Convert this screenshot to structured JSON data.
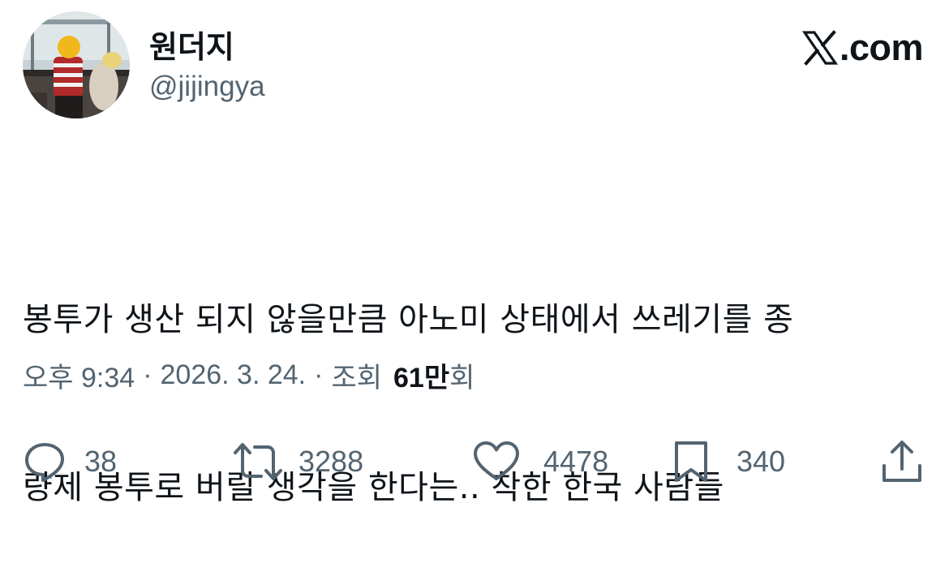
{
  "user": {
    "display_name": "원더지",
    "handle": "@jijingya",
    "avatar_icon": "profile-photo"
  },
  "site": {
    "logo_icon": "x-logo-icon",
    "domain": ".com"
  },
  "tweet": {
    "lines": [
      "봉투가 생산 되지 않을만큼 아노미 상태에서 쓰레기를 종",
      "량제 봉투로 버릴 생각을 한다는.. 착한 한국 사람들"
    ]
  },
  "meta": {
    "time": "오후 9:34",
    "separator": "·",
    "date": "2026. 3. 24.",
    "views_label": "조회",
    "views_count": "61만",
    "views_suffix": "회"
  },
  "actions": {
    "replies": "38",
    "reposts": "3288",
    "likes": "4478",
    "bookmarks": "340"
  },
  "colors": {
    "text_primary": "#0f1419",
    "text_secondary": "#536471",
    "background": "#ffffff"
  }
}
